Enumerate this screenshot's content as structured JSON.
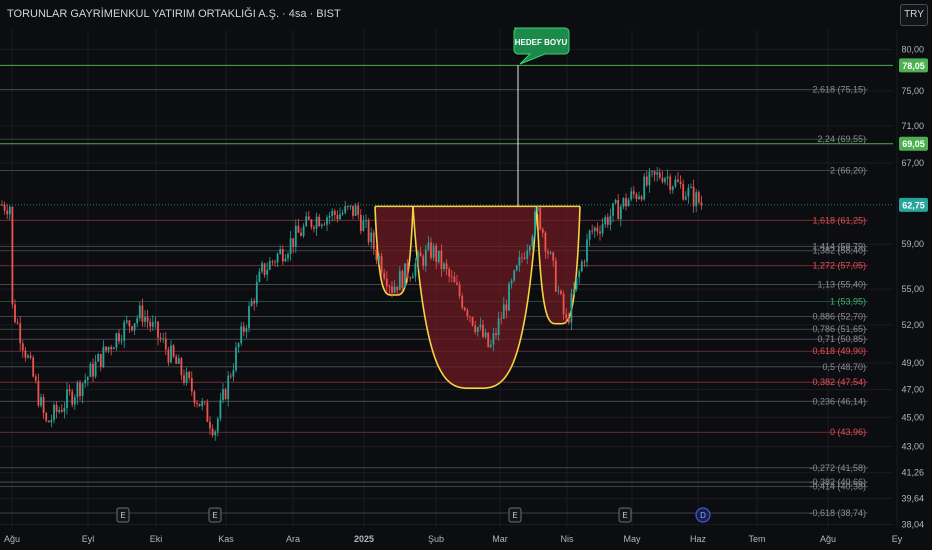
{
  "header": {
    "title": "TORUNLAR GAYRİMENKUL YATIRIM ORTAKLIĞI A.Ş. · 4sa · BIST",
    "currency_button": "TRY"
  },
  "colors": {
    "background": "#0c0d10",
    "grid": "#1a1c22",
    "candle_up": "#26a69a",
    "candle_down": "#ef5350",
    "pattern_fill": "#6b1a22",
    "pattern_stroke": "#f5d442",
    "fib_green": "#3bb273",
    "fib_red": "#e0505a",
    "fib_gray": "#8a8d94",
    "target_line": "#4caf50",
    "callout_green": "#1b8a4a",
    "price_badge": "#26a69a"
  },
  "chart_data": {
    "type": "candlestick",
    "x_labels": [
      "Ağu",
      "Eyl",
      "Eki",
      "Kas",
      "Ara",
      "2025",
      "Şub",
      "Mar",
      "Nis",
      "May",
      "Haz",
      "Tem",
      "Ağu",
      "Ey"
    ],
    "y_ticks": [
      80.0,
      75.0,
      71.0,
      67.0,
      59.0,
      55.0,
      52.0,
      49.0,
      47.0,
      45.0,
      43.0,
      41.26,
      39.64,
      38.04
    ],
    "y_tick_labels": [
      "80,00",
      "75,00",
      "71,00",
      "67,00",
      "59,00",
      "55,00",
      "52,00",
      "49,00",
      "47,00",
      "45,00",
      "43,00",
      "41,26",
      "39,64",
      "38,04"
    ],
    "y_scale": "log",
    "ylim": [
      37.9,
      82.5
    ],
    "price_series_anchors": [
      {
        "x": "Ağu",
        "y": 53.5
      },
      {
        "x": "Ağu-mid",
        "y": 44.5
      },
      {
        "x": "Eyl",
        "y": 48.0
      },
      {
        "x": "Eyl-late",
        "y": 51.5
      },
      {
        "x": "Eki",
        "y": 53.0
      },
      {
        "x": "Kas",
        "y": 44.2
      },
      {
        "x": "Kas-late",
        "y": 56.5
      },
      {
        "x": "Ara",
        "y": 61.5
      },
      {
        "x": "2025",
        "y": 62.2
      },
      {
        "x": "Oca",
        "y": 55.2
      },
      {
        "x": "Şub",
        "y": 58.5
      },
      {
        "x": "Şub-late",
        "y": 50.0
      },
      {
        "x": "Mar",
        "y": 56.0
      },
      {
        "x": "Mar-late",
        "y": 62.0
      },
      {
        "x": "Nis",
        "y": 52.0
      },
      {
        "x": "Nis-mid",
        "y": 60.0
      },
      {
        "x": "May",
        "y": 63.0
      },
      {
        "x": "May-late",
        "y": 66.0
      },
      {
        "x": "Haz",
        "y": 62.75
      }
    ],
    "last_price": "62,75",
    "last_price_value": 62.75,
    "fib_levels": [
      {
        "label": "2,618 (75,15)",
        "value": 75.15,
        "color": "gray"
      },
      {
        "label": "2,24 (69,55)",
        "value": 69.55,
        "color": "gray"
      },
      {
        "label": "2 (66,20)",
        "value": 66.2,
        "color": "gray"
      },
      {
        "label": "1,618 (61,25)",
        "value": 61.25,
        "color": "red"
      },
      {
        "label": "1,414 (58,79)",
        "value": 58.79,
        "color": "gray"
      },
      {
        "label": "1,382 (58,40)",
        "value": 58.4,
        "color": "gray"
      },
      {
        "label": "1,272 (57,05)",
        "value": 57.05,
        "color": "red"
      },
      {
        "label": "1,13 (55,40)",
        "value": 55.4,
        "color": "gray"
      },
      {
        "label": "1 (53,95)",
        "value": 53.95,
        "color": "green"
      },
      {
        "label": "0,886 (52,70)",
        "value": 52.7,
        "color": "gray"
      },
      {
        "label": "0,786 (51,65)",
        "value": 51.65,
        "color": "gray"
      },
      {
        "label": "0,71 (50,85)",
        "value": 50.85,
        "color": "gray"
      },
      {
        "label": "0,618 (49,90)",
        "value": 49.9,
        "color": "red"
      },
      {
        "label": "0,5 (48,70)",
        "value": 48.7,
        "color": "gray"
      },
      {
        "label": "0,382 (47,54)",
        "value": 47.54,
        "color": "red"
      },
      {
        "label": "0,236 (46,14)",
        "value": 46.14,
        "color": "gray"
      },
      {
        "label": "0 (43,96)",
        "value": 43.96,
        "color": "red"
      },
      {
        "label": "-0,272 (41,58)",
        "value": 41.58,
        "color": "gray"
      },
      {
        "label": "-0,382 (40,66)",
        "value": 40.66,
        "color": "gray"
      },
      {
        "label": "-0,414 (40,38)",
        "value": 40.38,
        "color": "gray"
      },
      {
        "label": "-0,618 (38,74)",
        "value": 38.74,
        "color": "gray"
      }
    ],
    "horizontal_lines": [
      {
        "label": "78,05",
        "value": 78.05
      },
      {
        "label": "69,05",
        "value": 69.05
      }
    ],
    "pattern": {
      "neckline": 62.6,
      "left_cup_low": 54.5,
      "main_cup_low": 47.1,
      "right_cup_low": 52.1
    },
    "target_callout": "HEDEF BOYU",
    "event_markers": [
      "E",
      "E",
      "E",
      "E",
      "D"
    ],
    "event_marker_x": [
      "Eki-early",
      "Kas",
      "Mar",
      "May",
      "Haz"
    ]
  }
}
